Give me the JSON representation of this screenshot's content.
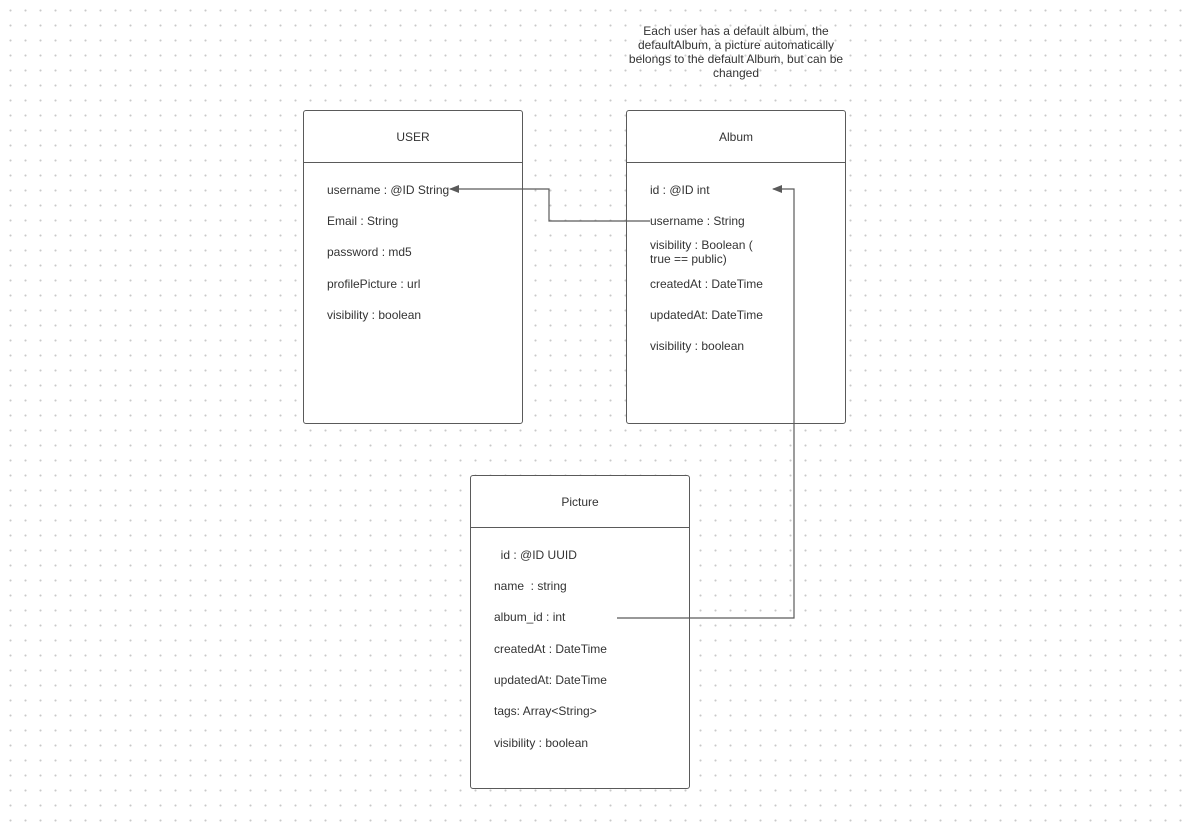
{
  "note": {
    "text": "Each user has a default album, the defaultAlbum, a picture automatically belongs to the default Album, but can be changed"
  },
  "entities": {
    "user": {
      "title": "USER",
      "fields": [
        "username : @ID String",
        "Email : String",
        "password : md5",
        "profilePicture : url",
        "visibility : boolean"
      ]
    },
    "album": {
      "title": "Album",
      "fields": [
        "id : @ID int",
        "username : String",
        "visibility : Boolean ( true == public)",
        "createdAt : DateTime",
        "updatedAt: DateTime",
        "visibility : boolean"
      ]
    },
    "picture": {
      "title": "Picture",
      "fields": [
        "  id : @ID UUID",
        "name  : string",
        "album_id : int",
        "createdAt : DateTime",
        "updatedAt: DateTime",
        "tags: Array<String>",
        "visibility : boolean"
      ]
    }
  },
  "colors": {
    "stroke": "#5a5a5a",
    "text": "#333333",
    "background": "#ffffff",
    "grid_dot": "#c9c9c9"
  }
}
